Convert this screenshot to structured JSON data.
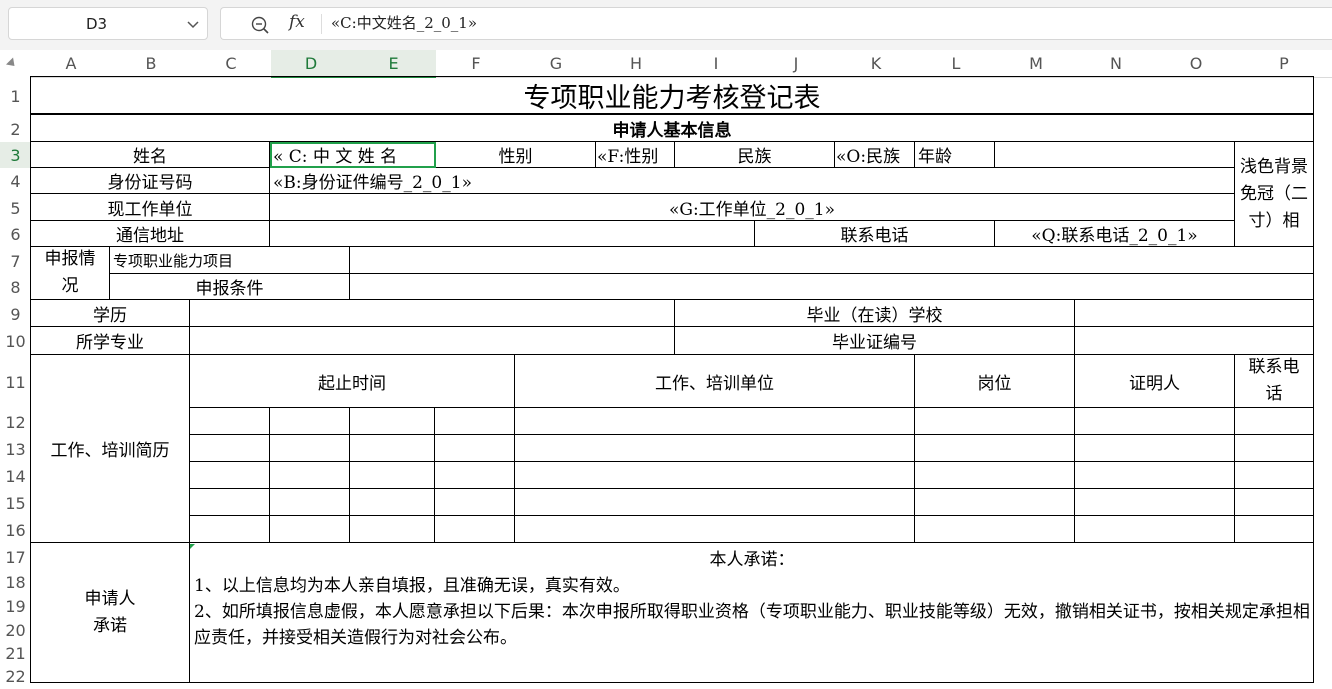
{
  "toolbar": {
    "cell_ref": "D3",
    "fx_label": "fx",
    "formula": "«C:中文姓名_2_0_1»"
  },
  "columns": [
    "A",
    "B",
    "C",
    "D",
    "E",
    "F",
    "G",
    "H",
    "I",
    "J",
    "K",
    "L",
    "M",
    "N",
    "O",
    "P"
  ],
  "rows": [
    "1",
    "2",
    "3",
    "4",
    "5",
    "6",
    "7",
    "8",
    "9",
    "10",
    "11",
    "12",
    "13",
    "14",
    "15",
    "16",
    "17",
    "18",
    "19",
    "20",
    "21",
    "22"
  ],
  "selected_cell": {
    "column": "D",
    "row": "3"
  },
  "form": {
    "title": "专项职业能力考核登记表",
    "section_basic": "申请人基本信息",
    "name_label": "姓名",
    "name_value": "« C: 中 文 姓 名",
    "gender_label": "性别",
    "gender_value": "«F:性别",
    "ethnicity_label": "民族",
    "ethnicity_value": "«O:民族",
    "age_label": "年龄",
    "photo_note": "浅色背景免冠（二寸）相",
    "id_label": "身份证号码",
    "id_value": "«B:身份证件编号_2_0_1»",
    "employer_label": "现工作单位",
    "employer_value": "«G:工作单位_2_0_1»",
    "address_label": "通信地址",
    "phone_label": "联系电话",
    "phone_value": "«Q:联系电话_2_0_1»",
    "apply_label": "申报情况",
    "apply_project": "专项职业能力项目",
    "apply_condition": "申报条件",
    "education_label": "学历",
    "school_label": "毕业（在读）学校",
    "major_label": "所学专业",
    "cert_no_label": "毕业证编号",
    "history_label": "工作、培训简历",
    "history_headers": [
      "起止时间",
      "工作、培训单位",
      "岗位",
      "证明人",
      "联系电话"
    ],
    "promise_label": "申请人承诺",
    "promise_title": "本人承诺：",
    "promise_lines": [
      "1、以上信息均为本人亲自填报，且准确无误，真实有效。",
      "2、如所填报信息虚假，本人愿意承担以下后果：本次申报所取得职业资格（专项职业能力、职业技能等级）无效，撤销相关证书，按相关规定承担相应责任，并接受相关造假行为对社会公布。"
    ]
  }
}
